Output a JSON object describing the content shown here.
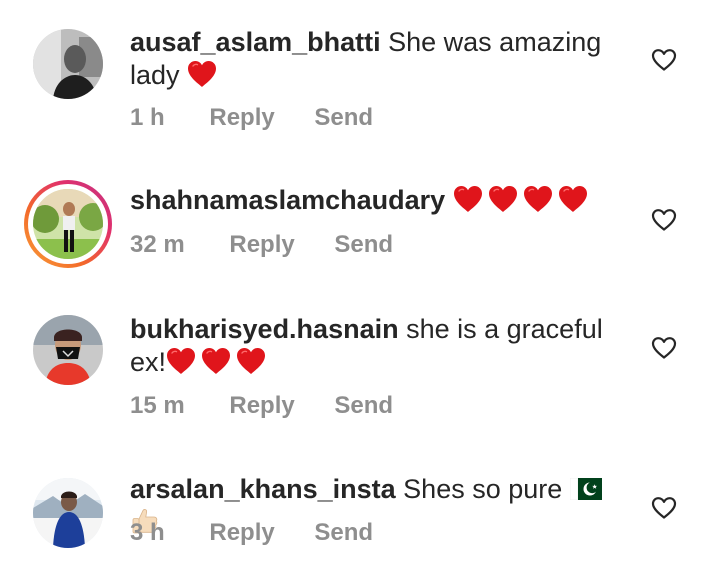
{
  "comments": [
    {
      "username": "ausaf_aslam_bhatti",
      "text": "She was amazing lady",
      "emoji": "heart",
      "time": "1 h",
      "reply_label": "Reply",
      "send_label": "Send",
      "avatar_style": "grayscale-photo"
    },
    {
      "username": "shahnamaslamchaudary",
      "text": "",
      "emoji": "heart x4",
      "time": "32 m",
      "reply_label": "Reply",
      "send_label": "Send",
      "avatar_style": "story-ring-photo"
    },
    {
      "username": "bukharisyed.hasnain",
      "text": "she is a graceful ex!",
      "emoji": "heart x3",
      "time": "15 m",
      "reply_label": "Reply",
      "send_label": "Send",
      "avatar_style": "masked-person-photo"
    },
    {
      "username": "arsalan_khans_insta",
      "text": "Shes so pure",
      "emoji": "pakistan-flag, thumbs-up",
      "time": "3 h",
      "reply_label": "Reply",
      "send_label": "Send",
      "avatar_style": "snow-photo"
    }
  ],
  "colors": {
    "text": "#262626",
    "secondary": "#8e8e8e",
    "heart_emoji": "#e0151b",
    "like_icon": "#262626"
  },
  "icons": {
    "like": "heart-outline-icon",
    "heart_emoji": "red-heart-emoji"
  }
}
